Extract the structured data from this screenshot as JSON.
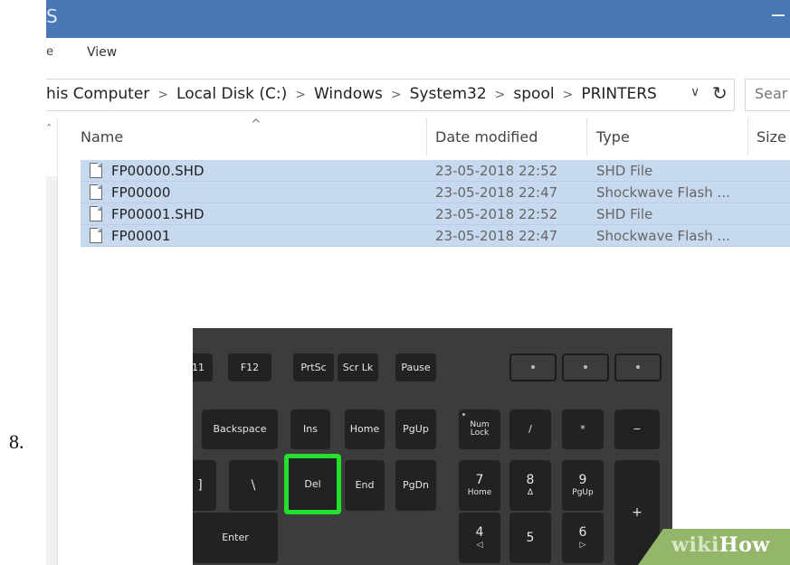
{
  "step_number": "8.",
  "window": {
    "title_fragment": "S",
    "ribbon": {
      "file_fragment": "e",
      "view_label": "View"
    },
    "breadcrumb": [
      "his Computer",
      "Local Disk (C:)",
      "Windows",
      "System32",
      "spool",
      "PRINTERS"
    ],
    "search_placeholder": "Sear",
    "columns": {
      "name": "Name",
      "date": "Date modified",
      "type": "Type",
      "size": "Size"
    },
    "files": [
      {
        "name": "FP00000.SHD",
        "date": "23-05-2018 22:52",
        "type": "SHD File"
      },
      {
        "name": "FP00000",
        "date": "23-05-2018 22:47",
        "type": "Shockwave Flash ..."
      },
      {
        "name": "FP00001.SHD",
        "date": "23-05-2018 22:52",
        "type": "SHD File"
      },
      {
        "name": "FP00001",
        "date": "23-05-2018 22:47",
        "type": "Shockwave Flash ..."
      }
    ],
    "colors": {
      "titlebar": "#4a77b5",
      "selection": "#c7d9ee"
    }
  },
  "keyboard": {
    "function_row": [
      "11",
      "F12",
      "PrtSc",
      "Scr Lk",
      "Pause"
    ],
    "row2": [
      "Backspace",
      "Ins",
      "Home",
      "PgUp"
    ],
    "numlock": [
      "Num",
      "Lock"
    ],
    "num_ops": [
      "/",
      "*",
      "−"
    ],
    "row3": [
      "]",
      "\\",
      "Del",
      "End",
      "PgDn"
    ],
    "num_row3": [
      {
        "main": "7",
        "sub": "Home"
      },
      {
        "main": "8",
        "sub": "Δ"
      },
      {
        "main": "9",
        "sub": "PgUp"
      }
    ],
    "plus": "+",
    "enter": "Enter",
    "num_row4": [
      {
        "main": "4",
        "sub": "◁"
      },
      {
        "main": "5",
        "sub": ""
      },
      {
        "main": "6",
        "sub": "▷"
      }
    ],
    "highlight_color": "#22e02c"
  },
  "watermark": {
    "part1": "wiki",
    "part2": "How"
  }
}
